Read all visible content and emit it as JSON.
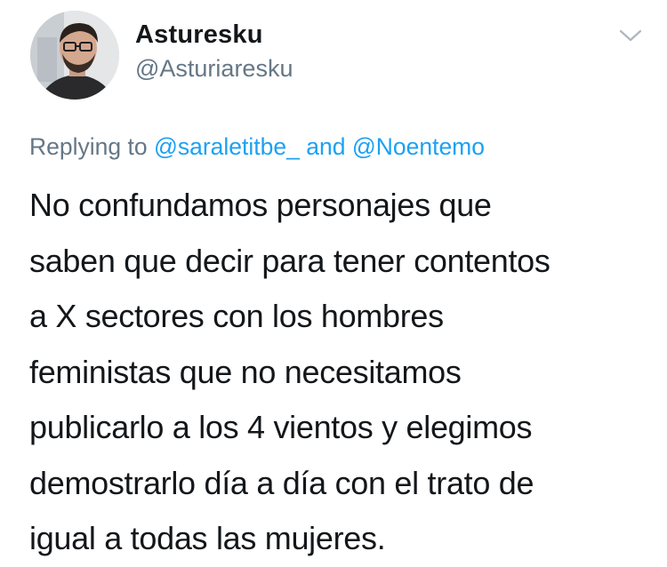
{
  "user": {
    "display_name": "Asturesku",
    "handle": "@Asturiaresku"
  },
  "reply": {
    "prefix": "Replying to",
    "mention_1": "@saraletitbe_",
    "conjunction": "and",
    "mention_2": "@Noentemo"
  },
  "tweet": {
    "lines": [
      "No confundamos personajes que",
      "saben que decir para tener contentos",
      "a X sectores con los hombres",
      "feministas que no necesitamos",
      "publicarlo a los 4 vientos y elegimos",
      "demostrarlo día a día con el trato de",
      "igual a todas las mujeres."
    ]
  },
  "icons": {
    "menu": "chevron-down-icon",
    "avatar": "profile-photo"
  },
  "colors": {
    "text": "#14171a",
    "secondary": "#657786",
    "link": "#1da1f2"
  }
}
